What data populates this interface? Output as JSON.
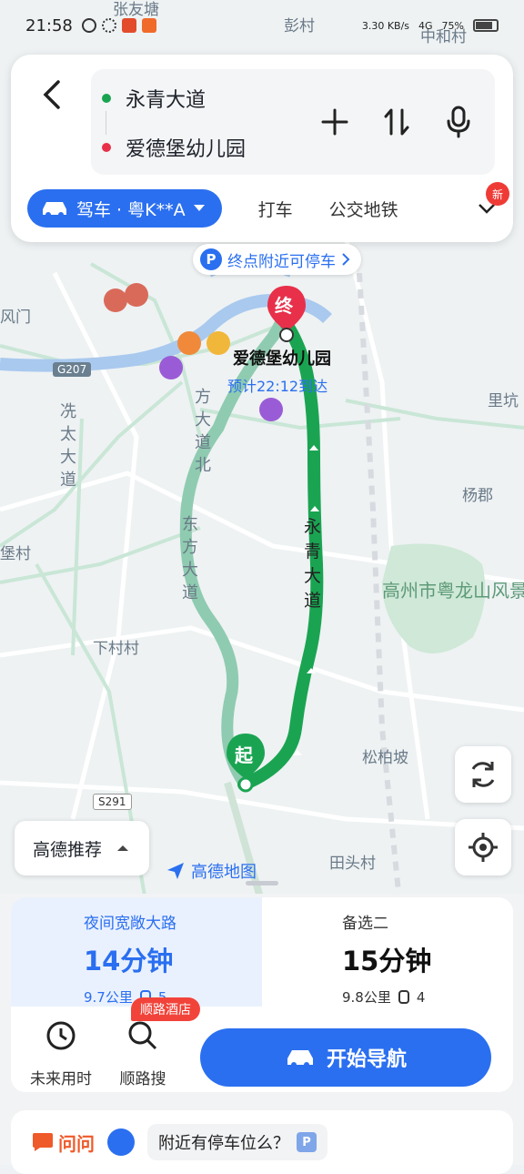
{
  "status_bar": {
    "time": "21:58",
    "net_speed": "3.30 KB/s",
    "network": "4G",
    "battery": "75%"
  },
  "header": {
    "start": "永青大道",
    "end": "爱德堡幼儿园"
  },
  "modes": {
    "drive": "驾车 · 粤K**A",
    "taxi": "打车",
    "transit": "公交地铁",
    "new_badge": "新"
  },
  "map": {
    "parking_tip": "终点附近可停车",
    "dest_marker": "终",
    "start_marker": "起",
    "dest_name": "爱德堡幼儿园",
    "eta": "预计22:12到达",
    "labels": {
      "pengcun": "彭村",
      "zhangyoutang": "张友塘",
      "zhonghecun": "中和村",
      "fengmen": "风门",
      "likeng": "里坑",
      "yangjun": "杨郡",
      "xiacuncun": "下村村",
      "songbaipo": "松柏坡",
      "tiantoucun": "田头村",
      "jiancun": "堡村",
      "scenic": "高州市粤龙山风景区",
      "xiantai": "冼太大道",
      "dongfang_north": "方大道北",
      "dongfang": "东方大道",
      "yongqing": "永青大道"
    },
    "shields": {
      "g207": "G207",
      "s291": "S291"
    },
    "provider": "高德地图",
    "sort_label": "高德推荐"
  },
  "routes": [
    {
      "name": "夜间宽敞大路",
      "duration": "14分钟",
      "distance": "9.7公里",
      "lights": "5"
    },
    {
      "name": "备选二",
      "duration": "15分钟",
      "distance": "9.8公里",
      "lights": "4"
    }
  ],
  "actions": {
    "future": "未来用时",
    "along": "顺路搜",
    "hotel_badge": "顺路酒店",
    "navigate": "开始导航"
  },
  "ask": {
    "brand": "问问",
    "question": "附近有停车位么？"
  },
  "colors": {
    "accent": "#2a6ff0",
    "route_main": "#1aa452",
    "route_alt": "#8fcbb0",
    "marker": "#e8304a"
  }
}
